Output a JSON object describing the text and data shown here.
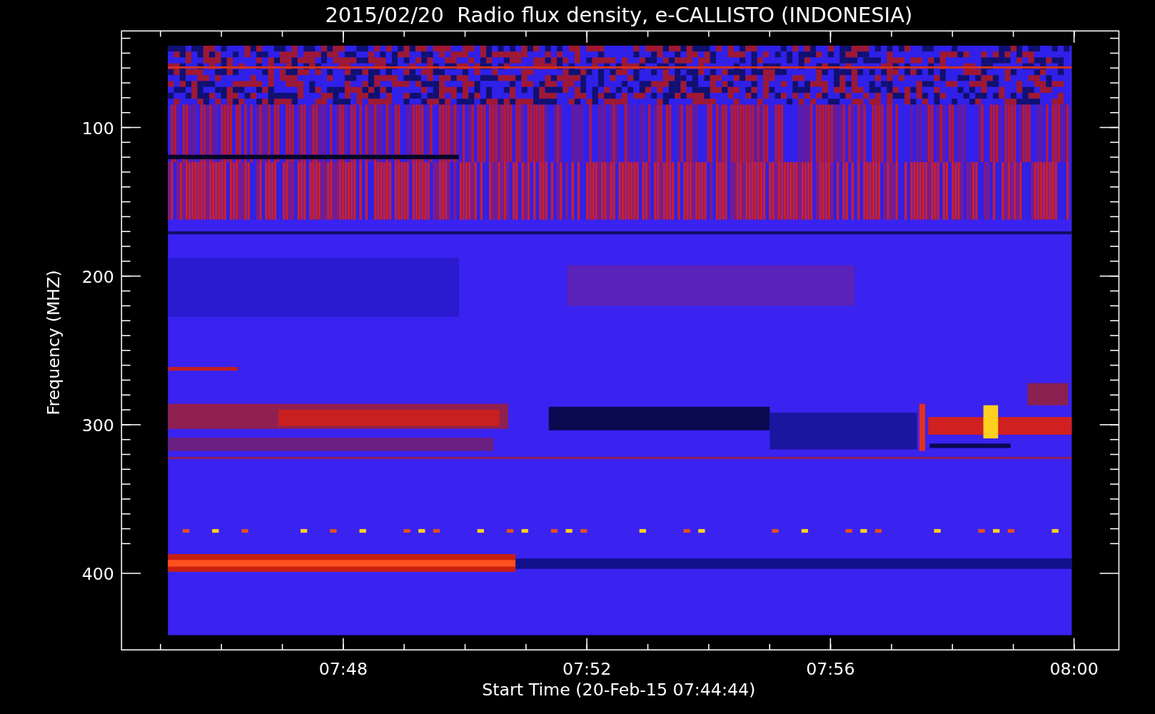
{
  "title": "2015/02/20  Radio flux density, e-CALLISTO (INDONESIA)",
  "ylabel": "Frequency (MHZ)",
  "xlabel": "Start Time (20-Feb-15 07:44:44)",
  "xticks": [
    "07:48",
    "07:52",
    "07:56",
    "08:00"
  ],
  "yticks": [
    "100",
    "200",
    "300",
    "400"
  ]
}
